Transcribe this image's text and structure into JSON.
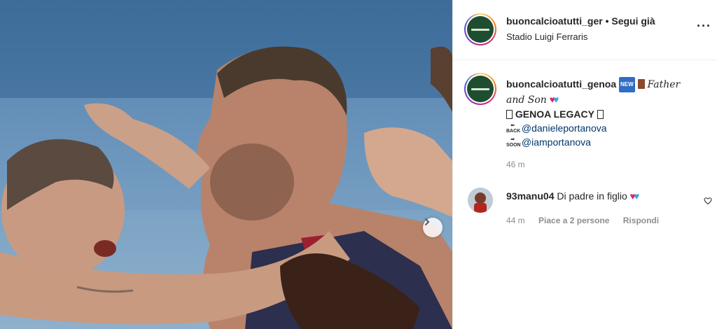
{
  "post": {
    "username": "buoncalcioatutti_ger",
    "separator": "•",
    "follow_status": "Segui già",
    "location": "Stadio Luigi Ferraris",
    "more_icon": "more-options-icon"
  },
  "caption": {
    "username": "buoncalcioatutti_genoa",
    "new_badge": "NEW",
    "text_father": "Father",
    "text_and_son": "and Son",
    "legacy": "GENOA LEGACY",
    "back_label": "BACK",
    "soon_label": "SOON",
    "mention_1": "@danieleportanova",
    "mention_2": "@iamportanova",
    "time": "46 m"
  },
  "comment": {
    "username": "93manu04",
    "text": "Di padre in figlio",
    "time": "44 m",
    "likes": "Piace a 2 persone",
    "reply": "Rispondi"
  },
  "colors": {
    "heart_red": "#e0245e",
    "heart_blue": "#3ea0e8",
    "link": "#00376b"
  }
}
